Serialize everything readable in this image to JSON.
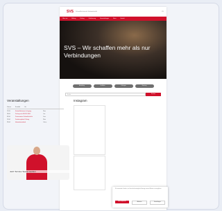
{
  "site": {
    "logo": "SVS",
    "tagline": "Schweißtechnische Verbandsstelle",
    "lang": "EN"
  },
  "nav": {
    "items": [
      "Über uns",
      "Bildung",
      "Prüfung",
      "Zertifizierung",
      "Veranstaltungen",
      "News",
      "Kontakt"
    ]
  },
  "hero": {
    "title": "SVS – Wir schaffen mehr als nur Verbindungen"
  },
  "quick_links": [
    "Ausbildung",
    "Zertifikate",
    "Prüfungen",
    "Beratung"
  ],
  "search": {
    "placeholder": "Suche",
    "button": "Suchen"
  },
  "events": {
    "heading": "Veranstaltungen",
    "columns": [
      "Datum",
      "Kurstitel",
      "Ort"
    ],
    "rows": [
      {
        "date": "12.03.",
        "title": "Schweißfachmann Lehrgang",
        "location": "Wien"
      },
      {
        "date": "18.03.",
        "title": "Prüfung nach EN ISO 9606",
        "location": "Linz"
      },
      {
        "date": "02.04.",
        "title": "Praxisseminar Schweißaufsicht",
        "location": "Graz"
      },
      {
        "date": "15.04.",
        "title": "Zerstörungsfreie Prüfung",
        "location": "Wien"
      },
      {
        "date": "23.04.",
        "title": "Informationsabend",
        "location": "Online"
      }
    ]
  },
  "news": {
    "heading": "Instagram"
  },
  "promo": {
    "caption": "Jetzt Teil des Teams werden"
  },
  "cookie": {
    "text": "Wir verwenden Cookies, um Ihnen die bestmögliche Nutzung unserer Website zu ermöglichen.",
    "accept": "Alle akzeptieren",
    "decline": "Ablehnen",
    "settings": "Einstellungen"
  },
  "colors": {
    "brand_red": "#d0112b",
    "background": "#e9edf5"
  }
}
